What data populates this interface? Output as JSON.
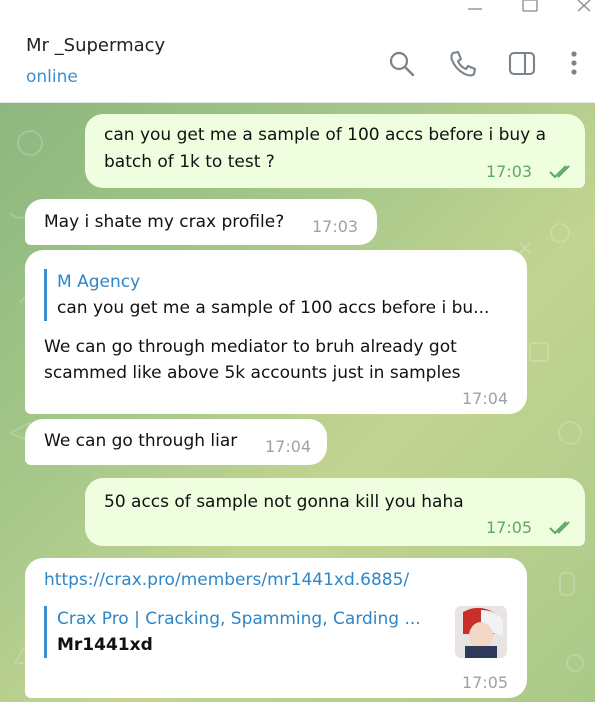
{
  "window": {
    "minimize_icon": "minimize-icon",
    "maximize_icon": "maximize-icon",
    "close_icon": "close-icon"
  },
  "header": {
    "contact_name": "Mr _Supermacy",
    "status": "online",
    "icons": [
      "search-icon",
      "phone-icon",
      "sidebar-toggle-icon",
      "more-vertical-icon"
    ]
  },
  "colors": {
    "accent": "#3a8fd0",
    "outgoing_bubble": "#eefedf",
    "incoming_bubble": "#ffffff",
    "read_ticks": "#5fa764"
  },
  "messages": [
    {
      "direction": "out",
      "text_line1": "can you get me a sample of 100 accs before i buy a",
      "text_line2": "batch of 1k to test ?",
      "time": "17:03",
      "read": true
    },
    {
      "direction": "in",
      "text": "May i shate my crax profile?",
      "time": "17:03"
    },
    {
      "direction": "in",
      "reply_name": "M Agency",
      "reply_text": "can you get me a sample of 100 accs before i bu...",
      "text_line1": "We can go through mediator to bruh already got",
      "text_line2": "scammed like above 5k accounts just in samples",
      "time": "17:04"
    },
    {
      "direction": "in",
      "text": "We can go through liar",
      "time": "17:04"
    },
    {
      "direction": "out",
      "text": "50 accs of sample not gonna kill you haha",
      "time": "17:05",
      "read": true
    },
    {
      "direction": "in",
      "link": "https://crax.pro/members/mr1441xd.6885/",
      "preview_title": "Crax Pro | Cracking, Spamming, Carding ...",
      "preview_text": "Mr1441xd",
      "time": "17:05"
    }
  ]
}
